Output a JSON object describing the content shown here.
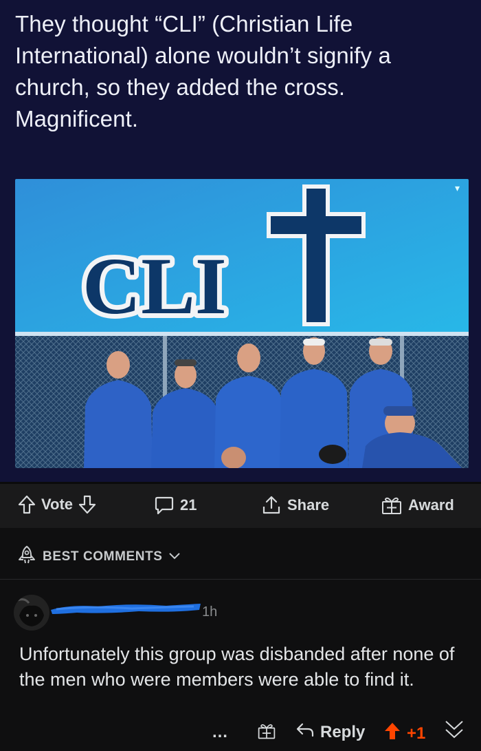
{
  "meme": {
    "caption": "They thought “CLI” (Christian Life International) alone wouldn’t signify a church, so they added the cross. Magnificent.",
    "logo_text": "CLI"
  },
  "post_actions": {
    "vote_label": "Vote",
    "comments_count": "21",
    "share_label": "Share",
    "award_label": "Award"
  },
  "comments_sort": {
    "label": "BEST COMMENTS"
  },
  "comment": {
    "time": "1h",
    "body": "Unfortunately this group was disbanded after none of the men who were members were able to find it.",
    "more_label": "…",
    "reply_label": "Reply",
    "score": "+1"
  },
  "colors": {
    "upvote_active": "#ff4500",
    "redaction": "#1f6fe0",
    "meme_background": "#111236"
  }
}
